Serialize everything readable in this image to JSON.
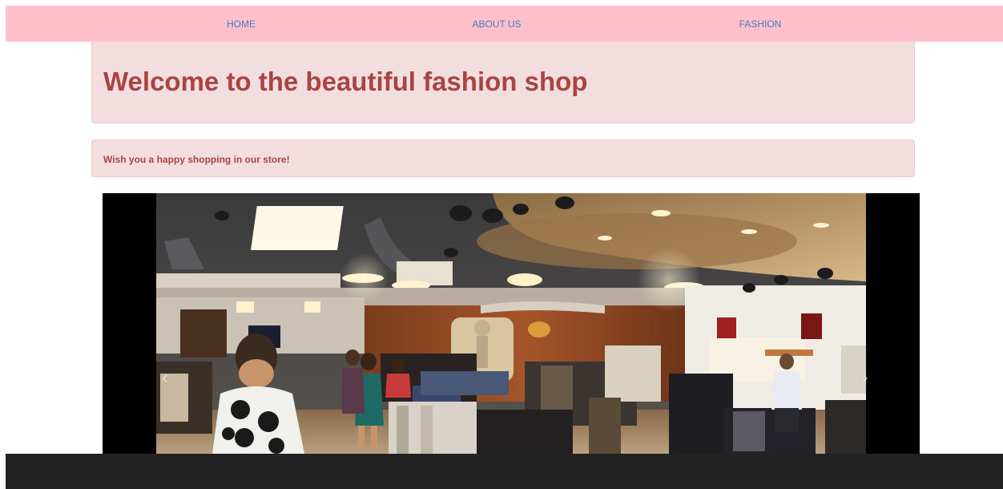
{
  "nav": {
    "items": [
      {
        "label": "HOME"
      },
      {
        "label": "ABOUT US"
      },
      {
        "label": "FASHION"
      }
    ]
  },
  "jumbotron": {
    "title": "Welcome to the beautiful fashion shop"
  },
  "alert": {
    "message": "Wish you a happy shopping in our store!"
  },
  "carousel": {
    "prev_icon": "chevron-left-icon",
    "next_icon": "chevron-right-icon"
  },
  "colors": {
    "navbar_bg": "#ffc0cb",
    "nav_link": "#4a7cc4",
    "panel_bg": "#f2dede",
    "panel_text": "#a94442",
    "footer_bg": "#222222"
  }
}
